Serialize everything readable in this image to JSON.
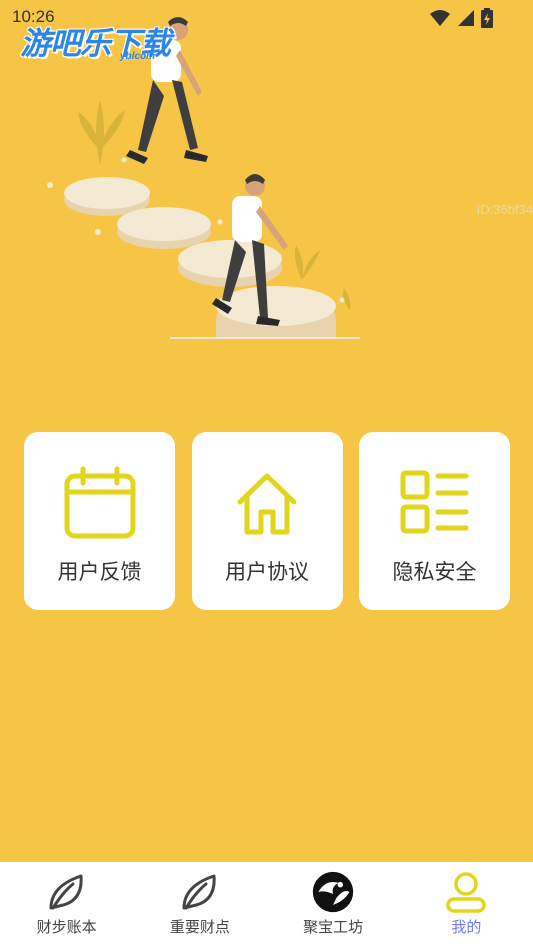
{
  "status_bar": {
    "time": "10:26"
  },
  "watermark": {
    "text": "游吧乐下载",
    "sub": "yblcom"
  },
  "id_label": "ID:36bf34",
  "cards": [
    {
      "label": "用户反馈",
      "icon": "calendar-icon"
    },
    {
      "label": "用户协议",
      "icon": "home-icon"
    },
    {
      "label": "隐私安全",
      "icon": "list-icon"
    }
  ],
  "tabs": [
    {
      "label": "财步账本",
      "icon": "leaf-icon",
      "active": false
    },
    {
      "label": "重要财点",
      "icon": "leaf-icon",
      "active": false
    },
    {
      "label": "聚宝工坊",
      "icon": "bird-logo-icon",
      "active": false
    },
    {
      "label": "我的",
      "icon": "user-icon",
      "active": true
    }
  ],
  "colors": {
    "background": "#f7c545",
    "accent_icon": "#e2d51a",
    "active_tab": "#6b7bff"
  }
}
